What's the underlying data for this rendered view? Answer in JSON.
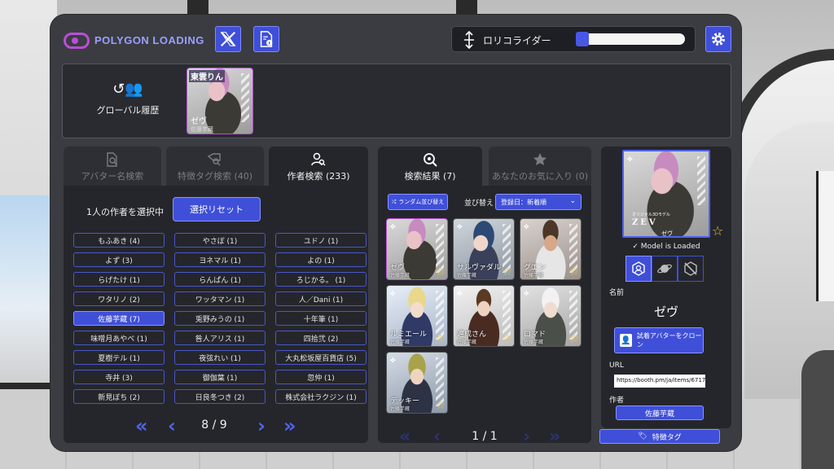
{
  "colors": {
    "accent": "#3f4fd8",
    "panel": "#3b3c41",
    "dark": "#25262b",
    "highlight": "#b84fd6",
    "star": "#e9c640"
  },
  "header": {
    "logo_text": "POLYGON LOADING",
    "x_icon": "x-logo-icon",
    "info_icon": "document-info-icon",
    "slider_label": "ロリコライダー",
    "slider_value": 0.0,
    "settings_icon": "gear-icon"
  },
  "history": {
    "label": "グローバル履歴",
    "card": {
      "title": "東雲りん",
      "name": "ゼヴ",
      "sub": "佐藤芋蔵"
    }
  },
  "left_tabs": [
    {
      "label": "アバター名検索"
    },
    {
      "label": "特徴タグ検索 (40)"
    },
    {
      "label": "作者検索 (233)"
    }
  ],
  "author_panel": {
    "selected_label": "1人の作者を選択中",
    "reset_label": "選択リセット",
    "authors": [
      "もふあき (4)",
      "やさぼ (1)",
      "ユドノ (1)",
      "よず (3)",
      "ヨネマル (1)",
      "よの (1)",
      "らげたけ (1)",
      "らんぱん (1)",
      "ろじかる。 (1)",
      "ワタリノ (2)",
      "ワッタマン (1)",
      "人／Dani (1)",
      "佐藤芋蔵 (7)",
      "兎野みうの (1)",
      "十年筆 (1)",
      "味噌月あやべ (1)",
      "咎人アリス (1)",
      "四拾弐 (2)",
      "夏樹テル (1)",
      "夜弦れい (1)",
      "大丸松坂屋百貨店 (5)",
      "寺井 (3)",
      "御伽葉 (1)",
      "忽仲 (1)",
      "新見ぼち (2)",
      "日良冬つき (2)",
      "株式会社ラクジン (1)"
    ],
    "selected_index": 12,
    "page": "8 / 9"
  },
  "mid_tabs": [
    {
      "label": "検索結果 (7)"
    },
    {
      "label": "あなたのお気に入り (0)"
    }
  ],
  "results_panel": {
    "random_label": "ランダム並び替え",
    "sort_label": "並び替え",
    "sort_value": "登録日：新着順",
    "cards": [
      {
        "name": "ゼヴ",
        "sub": "佐藤芋蔵"
      },
      {
        "name": "サルヴァダル",
        "sub": "佐藤芋蔵"
      },
      {
        "name": "グエン",
        "sub": "佐藤芋蔵"
      },
      {
        "name": "ルミエール",
        "sub": "佐藤芋蔵"
      },
      {
        "name": "遍成さん",
        "sub": "佐藤芋蔵"
      },
      {
        "name": "ロマド",
        "sub": "佐藤芋蔵"
      },
      {
        "name": "テッキー",
        "sub": "佐藤芋蔵"
      }
    ],
    "page": "1 / 1"
  },
  "detail": {
    "img_sub": "オリジナル3Dモデル",
    "img_title": "ZEV",
    "img_jp": "ゼヴ",
    "loaded_label": "✓ Model is Loaded",
    "name_label": "名前",
    "name_value": "ゼヴ",
    "clone_label": "試着アバターをクローン",
    "url_label": "URL",
    "url_value": "https://booth.pm/ja/items/6717",
    "author_label": "作者",
    "author_value": "佐藤芋蔵",
    "tag_label": "特徴タグ"
  }
}
